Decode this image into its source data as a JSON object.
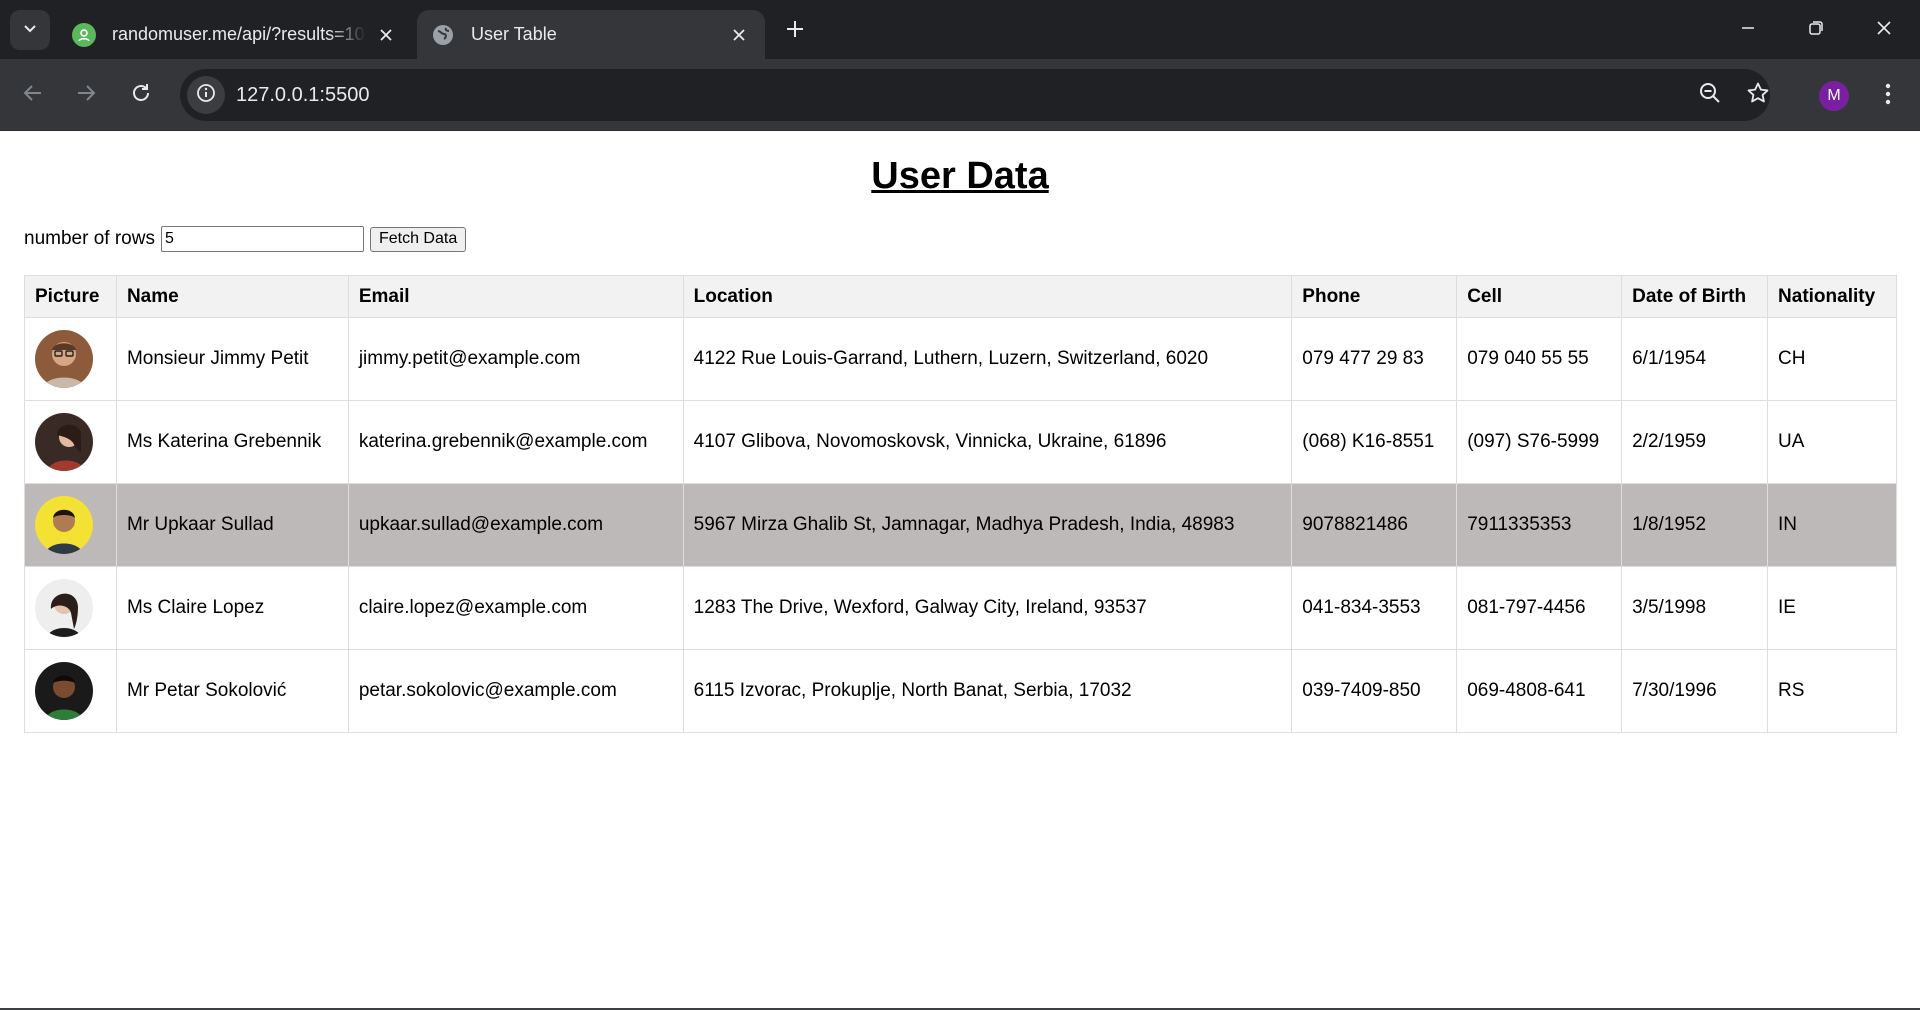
{
  "browser": {
    "tabs": [
      {
        "title": "randomuser.me/api/?results=10",
        "favicon": "randomuser-favicon",
        "active": false
      },
      {
        "title": "User Table",
        "favicon": "globe-icon",
        "active": true
      }
    ],
    "url": "127.0.0.1:5500",
    "profile_initial": "M",
    "colors": {
      "frame": "#202124",
      "toolbar": "#35363a",
      "profile": "#7b1fa2"
    }
  },
  "page": {
    "title": "User Data",
    "rows_label": "number of rows",
    "rows_value": "5",
    "fetch_label": "Fetch Data",
    "table": {
      "headers": [
        "Picture",
        "Name",
        "Email",
        "Location",
        "Phone",
        "Cell",
        "Date of Birth",
        "Nationality"
      ],
      "highlighted_row": 2,
      "rows": [
        {
          "name": "Monsieur Jimmy Petit",
          "email": "jimmy.petit@example.com",
          "location": "4122 Rue Louis-Garrand, Luthern, Luzern, Switzerland, 6020",
          "phone": "079 477 29 83",
          "cell": "079 040 55 55",
          "dob": "6/1/1954",
          "nat": "CH",
          "picture": "avatar-photo"
        },
        {
          "name": "Ms Katerina Grebennik",
          "email": "katerina.grebennik@example.com",
          "location": "4107 Glibova, Novomoskovsk, Vinnicka, Ukraine, 61896",
          "phone": "(068) K16-8551",
          "cell": "(097) S76-5999",
          "dob": "2/2/1959",
          "nat": "UA",
          "picture": "avatar-photo"
        },
        {
          "name": "Mr Upkaar Sullad",
          "email": "upkaar.sullad@example.com",
          "location": "5967 Mirza Ghalib St, Jamnagar, Madhya Pradesh, India, 48983",
          "phone": "9078821486",
          "cell": "7911335353",
          "dob": "1/8/1952",
          "nat": "IN",
          "picture": "avatar-photo"
        },
        {
          "name": "Ms Claire Lopez",
          "email": "claire.lopez@example.com",
          "location": "1283 The Drive, Wexford, Galway City, Ireland, 93537",
          "phone": "041-834-3553",
          "cell": "081-797-4456",
          "dob": "3/5/1998",
          "nat": "IE",
          "picture": "avatar-photo"
        },
        {
          "name": "Mr Petar Sokolović",
          "email": "petar.sokolovic@example.com",
          "location": "6115 Izvorac, Prokuplje, North Banat, Serbia, 17032",
          "phone": "039-7409-850",
          "cell": "069-4808-641",
          "dob": "7/30/1996",
          "nat": "RS",
          "picture": "avatar-photo"
        }
      ]
    }
  }
}
